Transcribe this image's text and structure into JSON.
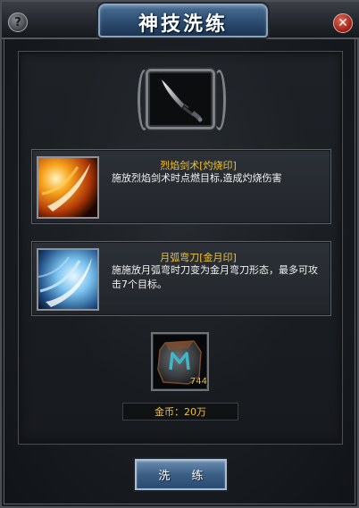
{
  "window": {
    "title": "神技洗练",
    "help_icon_glyph": "?",
    "close_icon_glyph": "✕"
  },
  "weapon": {
    "icon": "sword-icon"
  },
  "skills": [
    {
      "name": "烈焰剑术[灼烧印]",
      "description": "施放烈焰剑术时点燃目标,造成灼烧伤害",
      "icon": "fire-slash-icon",
      "accent": "#f2a020"
    },
    {
      "name": "月弧弯刀[金月印]",
      "description": "施施放月弧弯时刀变为金月弯刀形态，最多可攻击7个目标。",
      "icon": "ice-crescent-icon",
      "accent": "#9fd4f5"
    }
  ],
  "material": {
    "icon": "rune-stone-icon",
    "count": "744"
  },
  "cost": {
    "text": "金币：20万"
  },
  "action": {
    "refine_label": "洗 练"
  },
  "colors": {
    "gold": "#f2c230",
    "title_blue": "#2c4c70"
  }
}
